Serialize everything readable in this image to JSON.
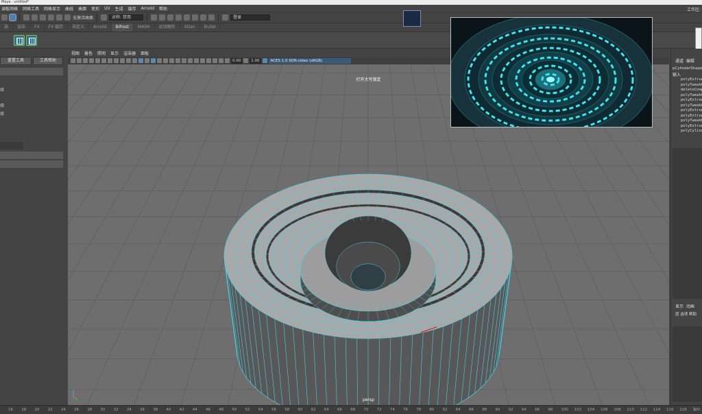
{
  "window": {
    "title": "Maya - untitled*",
    "workspace_label": "工作区:"
  },
  "menu": [
    "调板网格",
    "网格工具",
    "网格显示",
    "曲线",
    "曲面",
    "变形",
    "UV",
    "生成",
    "缓存",
    "Arnold",
    "帮助"
  ],
  "statusline": {
    "surface_label": "无激活曲面",
    "symmetry_label": "对称: 禁用",
    "login_label": "登录"
  },
  "shelf_tabs": [
    {
      "label": "选",
      "active": false
    },
    {
      "label": "渲染",
      "active": false
    },
    {
      "label": "FX",
      "active": false
    },
    {
      "label": "FX 缓存",
      "active": false
    },
    {
      "label": "自定义",
      "active": false
    },
    {
      "label": "Arnold",
      "active": false
    },
    {
      "label": "Bifrost",
      "active": true
    },
    {
      "label": "MASH",
      "active": false
    },
    {
      "label": "运动图形",
      "active": false
    },
    {
      "label": "XGen",
      "active": false
    },
    {
      "label": "Bullet",
      "active": false
    }
  ],
  "tool_settings": {
    "reset_label": "重置工具",
    "help_label": "工具帮助",
    "chars": [
      "择",
      "择",
      "择"
    ]
  },
  "viewport": {
    "menu": [
      "视图",
      "着色",
      "照明",
      "显示",
      "渲染器",
      "面板"
    ],
    "exposure": "0.00",
    "gamma": "1.00",
    "colorspace": "ACES 1.0 SDR-video (sRGB)",
    "hud_title": "打开大写锁定",
    "camera": "persp"
  },
  "channel_box": {
    "tabs": [
      "通道",
      "编辑"
    ],
    "object": "pCylinderShape",
    "inputs_label": "输入",
    "nodes": [
      "polyExtrude",
      "polyTweakU",
      "deleteComp",
      "polyTweakU",
      "polyExtrude",
      "polyTweakU",
      "polyExtrude",
      "polyExtrude",
      "polyTweakU",
      "polyExtrude",
      "polyCylind"
    ],
    "bottom_tabs": [
      "显示",
      "动画"
    ],
    "bottom_menu": [
      "层",
      "选项",
      "帮助"
    ]
  },
  "timeline": {
    "ticks": [
      "16",
      "18",
      "20",
      "22",
      "24",
      "26",
      "28",
      "30",
      "32",
      "34",
      "36",
      "38",
      "40",
      "42",
      "44",
      "46",
      "48",
      "50",
      "52",
      "54",
      "56",
      "58",
      "60",
      "62",
      "64",
      "66",
      "68",
      "70",
      "72",
      "74",
      "76",
      "78",
      "80",
      "82",
      "84",
      "86",
      "88",
      "90",
      "92",
      "94",
      "96",
      "98",
      "100",
      "102",
      "104",
      "106",
      "108",
      "110",
      "112",
      "114",
      "116",
      "118",
      "120"
    ],
    "end_label": "1"
  },
  "colors": {
    "accent": "#5c89b0",
    "wire": "#4ad0e8",
    "mesh": "#a8a8a8",
    "viewport_bg": "#6e6e6e"
  }
}
